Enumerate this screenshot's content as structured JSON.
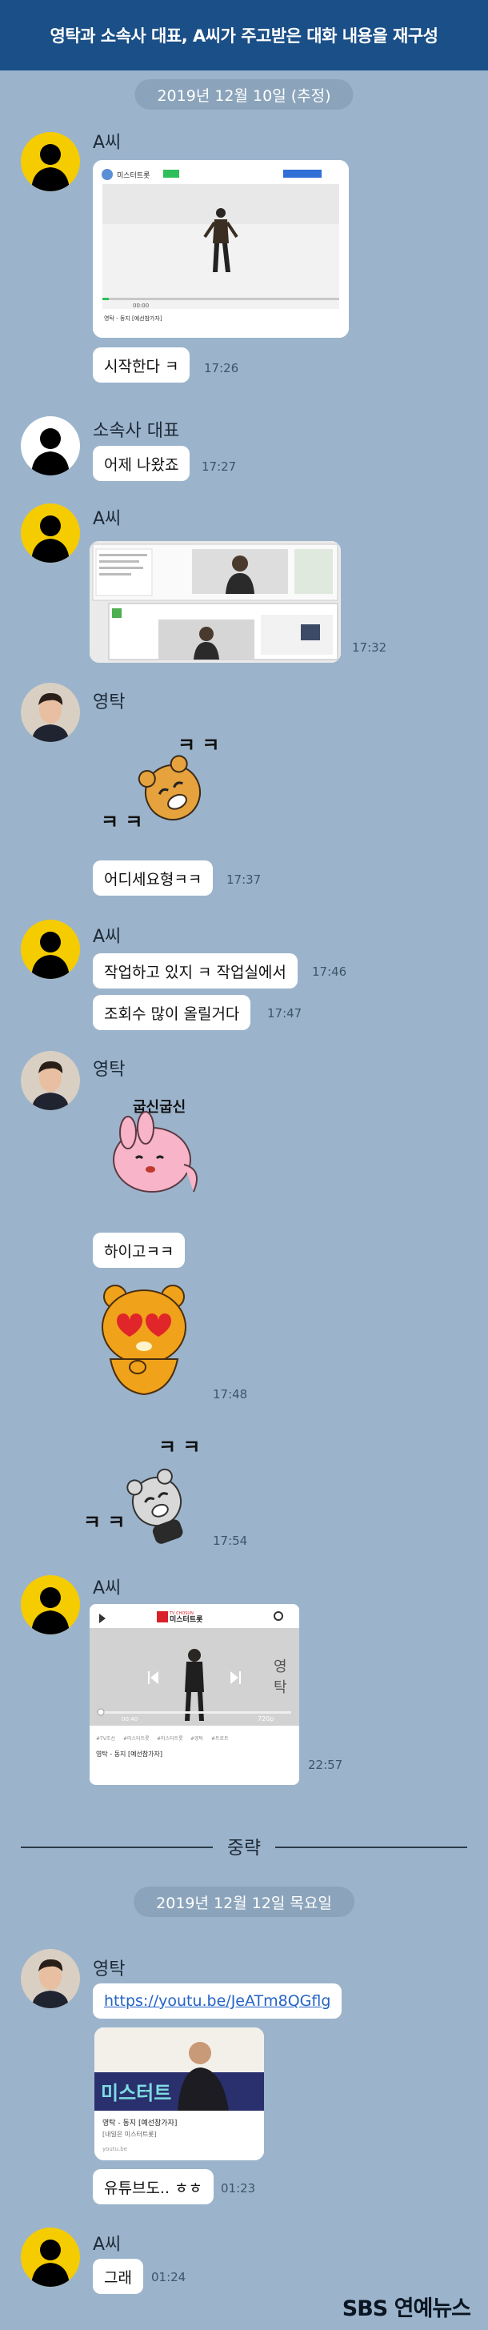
{
  "header": {
    "title": "영탁과 소속사 대표, A씨가 주고받은 대화 내용을 재구성"
  },
  "dates": {
    "first": "2019년 12월 10일 (추정)",
    "second": "2019년 12월 12일 목요일"
  },
  "divider": {
    "label": "중략"
  },
  "senders": {
    "a": "A씨",
    "ceo": "소속사 대표",
    "youngtak": "영탁"
  },
  "messages": {
    "m1": {
      "text": "시작한다 ㅋ",
      "time": "17:26"
    },
    "m2": {
      "text": "어제 나왔죠",
      "time": "17:27"
    },
    "m3": {
      "time": "17:32"
    },
    "m4": {
      "text": "어디세요형ㅋㅋ",
      "time": "17:37"
    },
    "m5": {
      "text": "작업하고 있지 ㅋ 작업실에서",
      "time": "17:46"
    },
    "m6": {
      "text": "조회수 많이 올릴거다",
      "time": "17:47"
    },
    "m7": {
      "text": "하이고ㅋㅋ",
      "time": ""
    },
    "m8": {
      "time": "17:48"
    },
    "m9": {
      "time": "17:54"
    },
    "m10": {
      "time": "22:57"
    },
    "m11": {
      "text": "https://youtu.be/JeATm8QGflg"
    },
    "m12": {
      "text": "유튜브도.. ㅎㅎ",
      "time": "01:23"
    },
    "m13": {
      "text": "그래",
      "time": "01:24"
    }
  },
  "screens": {
    "first": {
      "app_name": "미스터트롯",
      "caption": "영탁 - 동지 [예선참가자]",
      "time_code": "00:00"
    },
    "mobile": {
      "brand": "TV CHOSUN",
      "app_name": "미스터트롯",
      "time_code": "00:40",
      "quality": "720p",
      "side_text_1": "영",
      "side_text_2": "탁",
      "tags": [
        "#TV조선",
        "#미스터트롯",
        "#미스터트롯",
        "#영탁",
        "#트로트"
      ],
      "caption": "영탁 - 동지 [예선참가자]"
    },
    "link_card": {
      "overlay": "미스터트",
      "title": "영탁 - 동지 [예선참가자]",
      "subtitle": "[내일은 미스터트롯]",
      "site": "youtu.be"
    }
  },
  "stickers": {
    "kk": "ㅋ ㅋ",
    "gulshin": "굽신굽신"
  },
  "logo": {
    "text": "SBS 연예뉴스"
  }
}
